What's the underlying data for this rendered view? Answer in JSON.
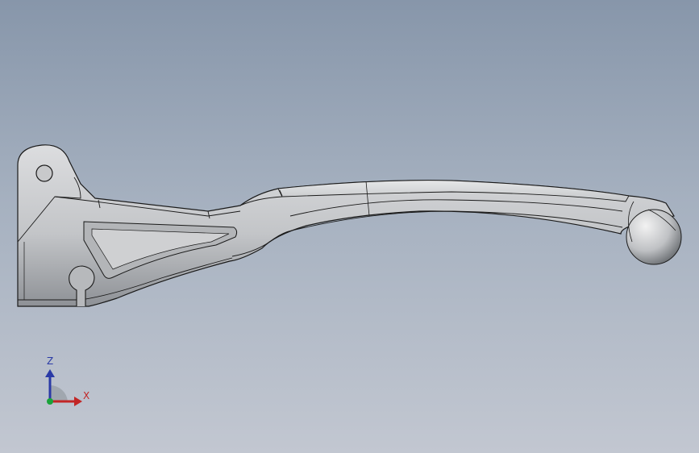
{
  "viewport": {
    "background_top": "#8796aa",
    "background_bottom": "#c2c7d1"
  },
  "model": {
    "part": "brake-lever",
    "face_color": "#c8c9cb",
    "edge_color": "#1a1a1a"
  },
  "triad": {
    "z_label": "Z",
    "x_label": "X",
    "z_color": "#2a3aa6",
    "x_color": "#c22626",
    "y_color": "#1aa33a"
  }
}
